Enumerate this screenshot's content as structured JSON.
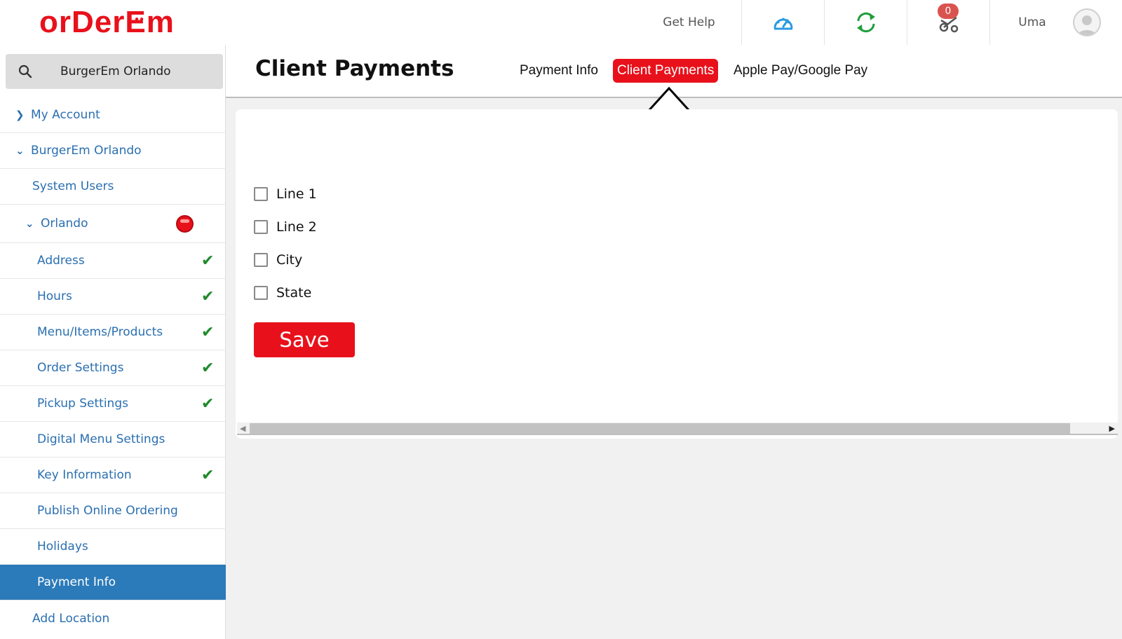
{
  "header": {
    "logo_text": "orDerEm",
    "help_label": "Get Help",
    "cart_count": "0",
    "user_name": "Uma",
    "icons": [
      "speedometer-icon",
      "refresh-icon",
      "scooter-icon",
      "user-avatar-icon"
    ],
    "colors": {
      "brand_red": "#e8111b",
      "dashboard_blue": "#2b9be0",
      "refresh_green": "#1e9e3a"
    }
  },
  "sidebar": {
    "search": {
      "value": "BurgerEm Orlando"
    },
    "items": [
      {
        "label": "My Account"
      },
      {
        "label": "BurgerEm Orlando"
      },
      {
        "label": "System Users"
      },
      {
        "label": "Orlando"
      },
      {
        "label": "Address"
      },
      {
        "label": "Hours"
      },
      {
        "label": "Menu/Items/Products"
      },
      {
        "label": "Order Settings"
      },
      {
        "label": "Pickup Settings"
      },
      {
        "label": "Digital Menu Settings"
      },
      {
        "label": "Key Information"
      },
      {
        "label": "Publish Online Ordering"
      },
      {
        "label": "Holidays"
      },
      {
        "label": "Payment Info"
      },
      {
        "label": "Add Location"
      }
    ],
    "active_item": "Payment Info",
    "completed_items": [
      "Address",
      "Hours",
      "Menu/Items/Products",
      "Order Settings",
      "Pickup Settings",
      "Key Information"
    ]
  },
  "main": {
    "title": "Client Payments",
    "tabs": [
      {
        "label": "Payment Info"
      },
      {
        "label": "Client Payments"
      },
      {
        "label": "Apple Pay/Google Pay"
      }
    ],
    "active_tab": "Client Payments",
    "fields": [
      {
        "label": "Line 1",
        "checked": false
      },
      {
        "label": "Line 2",
        "checked": false
      },
      {
        "label": "City",
        "checked": false
      },
      {
        "label": "State",
        "checked": false
      }
    ],
    "save_label": "Save"
  }
}
